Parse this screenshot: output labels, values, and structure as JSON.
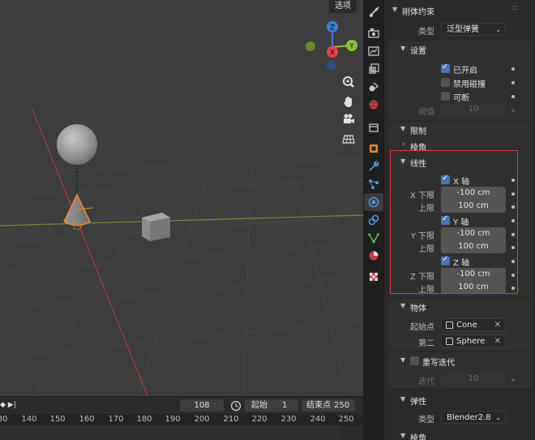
{
  "viewport": {
    "options_label": "选项",
    "gizmo": {
      "z": "Z",
      "x": "X",
      "y": "Y"
    },
    "colors": {
      "x_axis": "#e8424f",
      "y_axis": "#89c23a",
      "z_axis": "#3b7fd9",
      "active_outline": "#f0892a",
      "background": "#3d3d3d"
    },
    "nav_icons": [
      "zoom-icon",
      "hand-icon",
      "camera-icon",
      "grid-icon"
    ]
  },
  "timeline": {
    "play_icon": "jump-end-icon",
    "current_frame": "108",
    "clock_icon": "clock-icon",
    "start_label": "起始",
    "start_value": "1",
    "end_label": "结束点",
    "end_value": "250",
    "ticks": [
      "80",
      "140",
      "150",
      "160",
      "170",
      "180",
      "190",
      "200",
      "210",
      "220",
      "230",
      "240",
      "250"
    ]
  },
  "property_tabs": [
    "tool-icon",
    "render-icon",
    "output-icon",
    "view-layer-icon",
    "scene-icon",
    "world-icon",
    "collection-icon",
    "object-icon",
    "modifier-icon",
    "particles-icon",
    "physics-icon",
    "constraints-icon",
    "data-icon",
    "material-icon",
    "texture-icon"
  ],
  "panel": {
    "section_title": "刚体约束",
    "type_label": "类型",
    "type_value": "泛型弹簧",
    "settings": {
      "title": "设置",
      "enabled": "已开启",
      "disable_collisions": "禁用碰撞",
      "breakable": "可断",
      "threshold_label": "阈值",
      "threshold_value": "10"
    },
    "limits": {
      "title": "限制",
      "angular": "棱角",
      "linear": {
        "title": "线性",
        "x_axis": "X 轴",
        "x_lower_label": "X 下限",
        "x_lower": "-100 cm",
        "x_upper_label": "上限",
        "x_upper": "100 cm",
        "y_axis": "Y 轴",
        "y_lower_label": "Y 下限",
        "y_lower": "-100 cm",
        "y_upper_label": "上限",
        "y_upper": "100 cm",
        "z_axis": "Z 轴",
        "z_lower_label": "Z 下限",
        "z_lower": "-100 cm",
        "z_upper_label": "上限",
        "z_upper": "100 cm"
      }
    },
    "objects": {
      "title": "物体",
      "first_label": "起始点",
      "first_value": "Cone",
      "second_label": "第二",
      "second_value": "Sphere"
    },
    "override_iterations": {
      "title": "重写迭代",
      "iterations_label": "迭代",
      "iterations_value": "10"
    },
    "springs": {
      "title": "弹性",
      "type_label": "类型",
      "type_value": "Blender2.8"
    },
    "angular_bottom": "棱角"
  }
}
